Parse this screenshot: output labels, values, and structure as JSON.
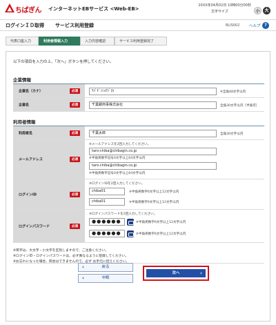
{
  "header": {
    "logo_text": "ちばぎん",
    "service_name": "インターネットEBサービス  <Web-EB>",
    "datetime": "20XX年04月02日 10時00分00秒",
    "text_size_label": "文字サイズ",
    "size_small": "小",
    "size_large": "大",
    "colors": {
      "brand": "#d0121b",
      "accent": "#2150a6",
      "step_active": "#2f7b5d"
    }
  },
  "titlebar": {
    "title": "ログインＩＤ取得",
    "subtitle": "サービス利用登録",
    "screen_id": "BLIS002",
    "help_label": "ヘルプ",
    "help_icon": "?"
  },
  "steps": [
    {
      "label": "代表口座入力",
      "active": false
    },
    {
      "label": "利用者情報入力",
      "active": true
    },
    {
      "label": "入力内容確認",
      "active": false
    },
    {
      "label": "サービス利用登録完了",
      "active": false
    }
  ],
  "main": {
    "instruction": "以下の項目を入力の上、「次へ」ボタンを押してください。",
    "company_section": {
      "title": "企業情報",
      "kana_label": "企業名（カナ）",
      "kana_value": "ﾁﾊﾞｷﾞﾝｼｮｳｼﾞ(ｶ",
      "kana_note": "※全角48文字以内",
      "name_label": "企業名",
      "name_value": "千葉銀商事株式会社",
      "name_note": "全角30文字以内［半角可］"
    },
    "user_section": {
      "title": "利用者情報",
      "user_label": "利用者名",
      "user_value": "千葉太郎",
      "user_note": "全角30文字以内",
      "email_label": "メールアドレス",
      "email_instruction": "※メールアドレスを2回入力してください。",
      "email_value1": "taro-chiba@chibagin.co.jp",
      "email_note1": "※半角英数字記号4文字以上64文字以内",
      "email_value2": "taro-chiba@chibagin.co.jp",
      "email_note2": "※半角英数字記号4文字以上64文字以内",
      "login_id_label": "ログインID",
      "login_id_instruction": "※ログインIDを2回入力してください。",
      "login_id_value1": "chiba01",
      "login_id_note1": "※半角英数字6文字以上12文字以内",
      "login_id_value2": "chiba01",
      "login_id_note2": "※半角英数字6文字以上12文字以内",
      "password_label": "ログインパスワード",
      "password_instruction": "※ログインパスワードを2回入力してください。",
      "password_value1": "●●●●●●",
      "password_note1": "※半角英数字6文字以上12文字以内",
      "password_value2": "●●●●●●",
      "password_note2": "※半角英数字6文字以上12文字以内",
      "required_badge": "必須",
      "keyboard_icon": "software-keyboard-icon"
    },
    "footnotes": [
      "※英字は、大文字・小文字を区別しますので、ご注意ください。",
      "※ログインID・ログインパスワードは、必ず異なるように登録してください。",
      "※お忘れになった場合、照会はできませんので、必ず お手元に控えください。"
    ],
    "buttons": {
      "back": "戻る",
      "cancel": "中断",
      "next": "次へ"
    }
  }
}
